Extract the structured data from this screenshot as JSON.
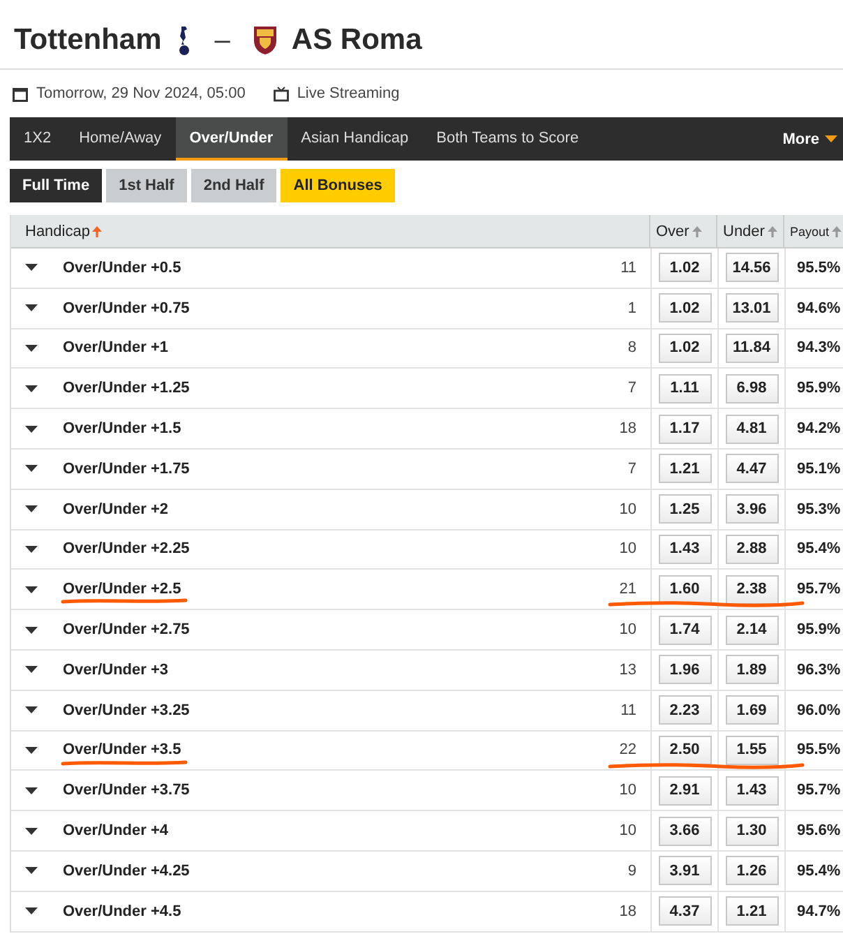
{
  "match": {
    "home": "Tottenham",
    "separator": "–",
    "away": "AS Roma"
  },
  "meta": {
    "date": "Tomorrow, 29 Nov 2024, 05:00",
    "stream": "Live Streaming"
  },
  "tabs": [
    {
      "label": "1X2",
      "selected": false
    },
    {
      "label": "Home/Away",
      "selected": false
    },
    {
      "label": "Over/Under",
      "selected": true
    },
    {
      "label": "Asian Handicap",
      "selected": false
    },
    {
      "label": "Both Teams to Score",
      "selected": false
    }
  ],
  "more": "More",
  "periods": [
    {
      "label": "Full Time",
      "selected": true,
      "kind": "period"
    },
    {
      "label": "1st Half",
      "selected": false,
      "kind": "period"
    },
    {
      "label": "2nd Half",
      "selected": false,
      "kind": "period"
    },
    {
      "label": "All Bonuses",
      "selected": false,
      "kind": "bonus"
    }
  ],
  "table": {
    "columns": [
      {
        "label": "Handicap",
        "sorted": true
      },
      {
        "label": "Over",
        "sorted": false
      },
      {
        "label": "Under",
        "sorted": false
      },
      {
        "label": "Payout",
        "sorted": false
      }
    ],
    "rows": [
      {
        "label": "Over/Under +0.5",
        "count": "11",
        "over": "1.02",
        "under": "14.56",
        "payout": "95.5%",
        "highlighted": false
      },
      {
        "label": "Over/Under +0.75",
        "count": "1",
        "over": "1.02",
        "under": "13.01",
        "payout": "94.6%",
        "highlighted": false
      },
      {
        "label": "Over/Under +1",
        "count": "8",
        "over": "1.02",
        "under": "11.84",
        "payout": "94.3%",
        "highlighted": false
      },
      {
        "label": "Over/Under +1.25",
        "count": "7",
        "over": "1.11",
        "under": "6.98",
        "payout": "95.9%",
        "highlighted": false
      },
      {
        "label": "Over/Under +1.5",
        "count": "18",
        "over": "1.17",
        "under": "4.81",
        "payout": "94.2%",
        "highlighted": false
      },
      {
        "label": "Over/Under +1.75",
        "count": "7",
        "over": "1.21",
        "under": "4.47",
        "payout": "95.1%",
        "highlighted": false
      },
      {
        "label": "Over/Under +2",
        "count": "10",
        "over": "1.25",
        "under": "3.96",
        "payout": "95.3%",
        "highlighted": false
      },
      {
        "label": "Over/Under +2.25",
        "count": "10",
        "over": "1.43",
        "under": "2.88",
        "payout": "95.4%",
        "highlighted": false
      },
      {
        "label": "Over/Under +2.5",
        "count": "21",
        "over": "1.60",
        "under": "2.38",
        "payout": "95.7%",
        "highlighted": true
      },
      {
        "label": "Over/Under +2.75",
        "count": "10",
        "over": "1.74",
        "under": "2.14",
        "payout": "95.9%",
        "highlighted": false
      },
      {
        "label": "Over/Under +3",
        "count": "13",
        "over": "1.96",
        "under": "1.89",
        "payout": "96.3%",
        "highlighted": false
      },
      {
        "label": "Over/Under +3.25",
        "count": "11",
        "over": "2.23",
        "under": "1.69",
        "payout": "96.0%",
        "highlighted": false
      },
      {
        "label": "Over/Under +3.5",
        "count": "22",
        "over": "2.50",
        "under": "1.55",
        "payout": "95.5%",
        "highlighted": true
      },
      {
        "label": "Over/Under +3.75",
        "count": "10",
        "over": "2.91",
        "under": "1.43",
        "payout": "95.7%",
        "highlighted": false
      },
      {
        "label": "Over/Under +4",
        "count": "10",
        "over": "3.66",
        "under": "1.30",
        "payout": "95.6%",
        "highlighted": false
      },
      {
        "label": "Over/Under +4.25",
        "count": "9",
        "over": "3.91",
        "under": "1.26",
        "payout": "95.4%",
        "highlighted": false
      },
      {
        "label": "Over/Under +4.5",
        "count": "18",
        "over": "4.37",
        "under": "1.21",
        "payout": "94.7%",
        "highlighted": false
      }
    ]
  }
}
